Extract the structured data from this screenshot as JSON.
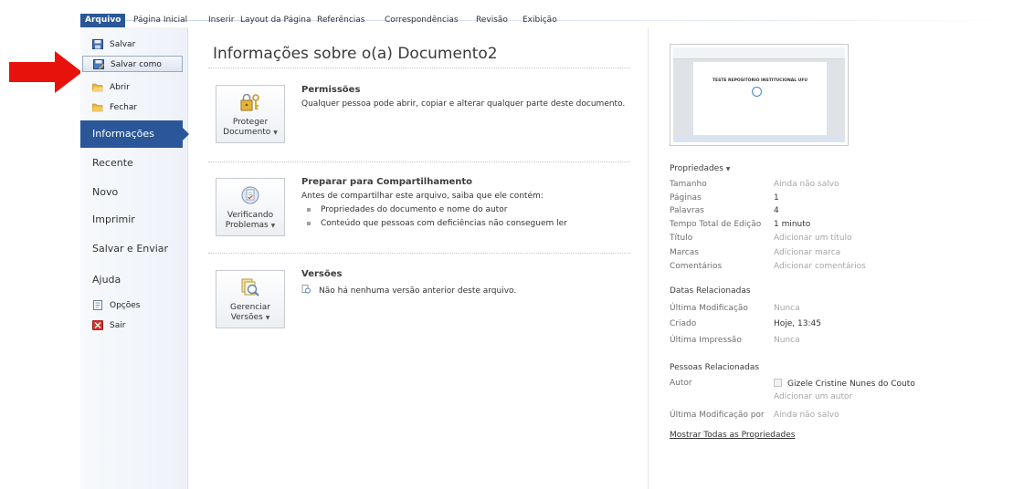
{
  "ribbon": {
    "tabs": [
      "Arquivo",
      "Página Inicial",
      "Inserir",
      "Layout da Página",
      "Referências",
      "Correspondências",
      "Revisão",
      "Exibição"
    ]
  },
  "backstage": {
    "small_items_top": [
      {
        "label": "Salvar",
        "icon": "save-icon"
      },
      {
        "label": "Salvar como",
        "icon": "save-as-icon"
      },
      {
        "label": "Abrir",
        "icon": "open-folder-icon"
      },
      {
        "label": "Fechar",
        "icon": "close-folder-icon"
      }
    ],
    "active_item": "Informações",
    "big_items": [
      "Recente",
      "Novo",
      "Imprimir",
      "Salvar e Enviar",
      "Ajuda"
    ],
    "small_items_bottom": [
      {
        "label": "Opções",
        "icon": "options-icon"
      },
      {
        "label": "Sair",
        "icon": "exit-icon"
      }
    ]
  },
  "info": {
    "title": "Informações sobre o(a) Documento2",
    "sections": [
      {
        "button_line1": "Proteger",
        "button_line2": "Documento",
        "heading": "Permissões",
        "text": "Qualquer pessoa pode abrir, copiar e alterar qualquer parte deste documento.",
        "icon": "lock-key-icon"
      },
      {
        "button_line1": "Verificando",
        "button_line2": "Problemas",
        "heading": "Preparar para Compartilhamento",
        "text": "Antes de compartilhar este arquivo, saiba que ele contém:",
        "bullets": [
          "Propriedades do documento e nome do autor",
          "Conteúdo que pessoas com deficiências não conseguem ler"
        ],
        "icon": "inspect-document-icon"
      },
      {
        "button_line1": "Gerenciar",
        "button_line2": "Versões",
        "heading": "Versões",
        "text": "Não há nenhuma versão anterior deste arquivo.",
        "icon": "manage-versions-icon"
      }
    ]
  },
  "preview": {
    "doc_heading": "TESTE REPOSITÓRIO INSTITUCIONAL UFU"
  },
  "properties": {
    "header": "Propriedades",
    "rows": [
      {
        "label": "Tamanho",
        "value": "Ainda não salvo",
        "muted": true
      },
      {
        "label": "Páginas",
        "value": "1",
        "muted": false
      },
      {
        "label": "Palavras",
        "value": "4",
        "muted": false
      },
      {
        "label": "Tempo Total de Edição",
        "value": "1 minuto",
        "muted": false
      },
      {
        "label": "Título",
        "value": "Adicionar um título",
        "muted": true
      },
      {
        "label": "Marcas",
        "value": "Adicionar marca",
        "muted": true
      },
      {
        "label": "Comentários",
        "value": "Adicionar comentários",
        "muted": true
      }
    ],
    "dates_header": "Datas Relacionadas",
    "dates": [
      {
        "label": "Última Modificação",
        "value": "Nunca",
        "muted": true
      },
      {
        "label": "Criado",
        "value": "Hoje, 13:45",
        "muted": false
      },
      {
        "label": "Última Impressão",
        "value": "Nunca",
        "muted": true
      }
    ],
    "people_header": "Pessoas Relacionadas",
    "author_label": "Autor",
    "author_name": "Gizele Cristine Nunes do Couto",
    "add_author": "Adicionar um autor",
    "last_modified_by_label": "Última Modificação por",
    "last_modified_by_value": "Ainda não salvo",
    "show_all_link": "Mostrar Todas as Propriedades"
  },
  "colors": {
    "accent": "#2b579a",
    "annotation_arrow": "#e8120c"
  }
}
